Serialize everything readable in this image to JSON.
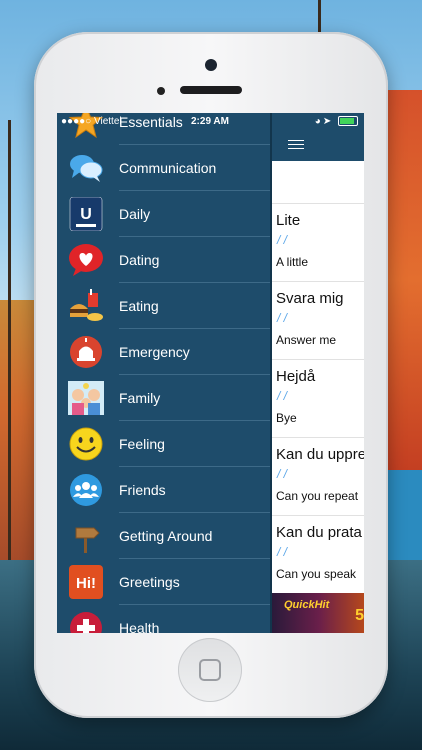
{
  "status_bar": {
    "carrier": "Viettel",
    "time": "2:29 AM"
  },
  "menu": [
    {
      "label": "Essentials",
      "icon": "star-icon"
    },
    {
      "label": "Communication",
      "icon": "speech-bubbles-icon"
    },
    {
      "label": "Daily",
      "icon": "daily-icon"
    },
    {
      "label": "Dating",
      "icon": "heart-bubble-icon"
    },
    {
      "label": "Eating",
      "icon": "food-icon"
    },
    {
      "label": "Emergency",
      "icon": "siren-icon"
    },
    {
      "label": "Family",
      "icon": "family-icon"
    },
    {
      "label": "Feeling",
      "icon": "smiley-icon"
    },
    {
      "label": "Friends",
      "icon": "people-icon"
    },
    {
      "label": "Getting Around",
      "icon": "signpost-icon"
    },
    {
      "label": "Greetings",
      "icon": "hi-icon"
    },
    {
      "label": "Health",
      "icon": "health-icon"
    }
  ],
  "daily_badge": "U",
  "greetings_badge": "Hi!",
  "phrases": [
    {
      "swedish": "Lite",
      "phonetic": "/ /",
      "english": "A little"
    },
    {
      "swedish": "Svara mig",
      "phonetic": "/ /",
      "english": "Answer me"
    },
    {
      "swedish": "Hejdå",
      "phonetic": "/ /",
      "english": "Bye"
    },
    {
      "swedish": "Kan du upprepa",
      "phonetic": "/ /",
      "english": "Can you repeat"
    },
    {
      "swedish": "Kan du prata",
      "phonetic": "/ /",
      "english": "Can you speak"
    }
  ],
  "ad": {
    "text": "QuickHit",
    "number": "5"
  },
  "colors": {
    "drawer": "#1e4c6b",
    "phonetic": "#5ca7e8",
    "battery": "#41d35a"
  }
}
